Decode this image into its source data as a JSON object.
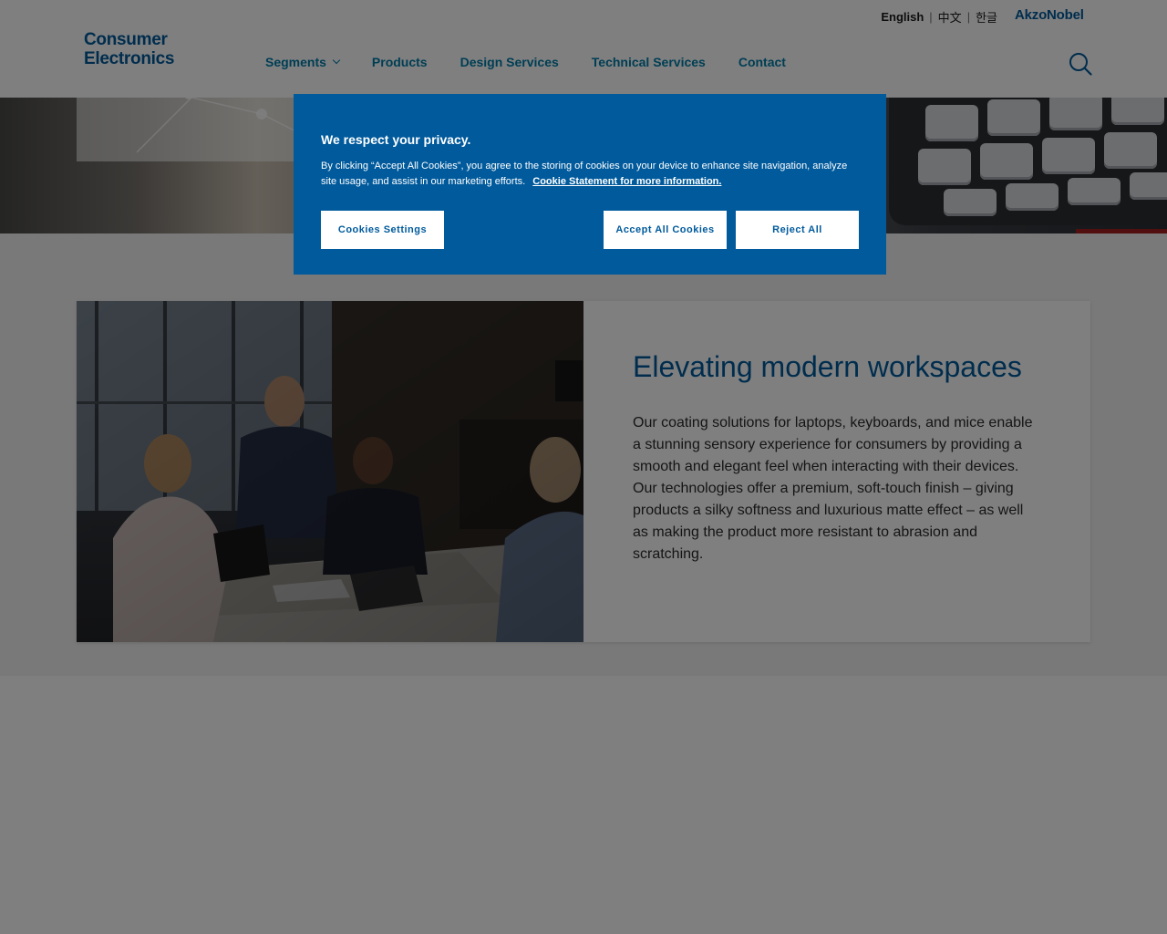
{
  "header": {
    "logo_line1": "Consumer",
    "logo_line2": "Electronics",
    "languages": [
      {
        "label": "English",
        "active": true
      },
      {
        "label": "中文",
        "active": false
      },
      {
        "label": "한글",
        "active": false
      }
    ],
    "brand": "AkzoNobel",
    "nav": [
      {
        "label": "Segments",
        "has_dropdown": true
      },
      {
        "label": "Products",
        "has_dropdown": false
      },
      {
        "label": "Design Services",
        "has_dropdown": false
      },
      {
        "label": "Technical Services",
        "has_dropdown": false
      },
      {
        "label": "Contact",
        "has_dropdown": false
      }
    ],
    "search_icon": "search-icon"
  },
  "card": {
    "title": "Elevating modern workspaces",
    "body": "Our coating solutions for laptops, keyboards, and mice enable a stunning sensory experience for consumers by providing a smooth and elegant feel when interacting with their devices. Our technologies offer a premium, soft-touch finish – giving products a silky softness and luxurious matte effect – as well as making the product more resistant to abrasion and scratching."
  },
  "cookie_banner": {
    "title": "We respect your privacy.",
    "text": "By clicking “Accept All Cookies”, you agree to the storing of cookies on your device to enhance site navigation, analyze site usage, and assist in our marketing efforts.",
    "link": "Cookie Statement for more information.",
    "settings_label": "Cookies Settings",
    "accept_label": "Accept All Cookies",
    "reject_label": "Reject All"
  },
  "colors": {
    "brand_blue": "#005a9c",
    "nav_teal": "#007ca8",
    "overlay": "rgba(0,0,0,0.5)"
  }
}
